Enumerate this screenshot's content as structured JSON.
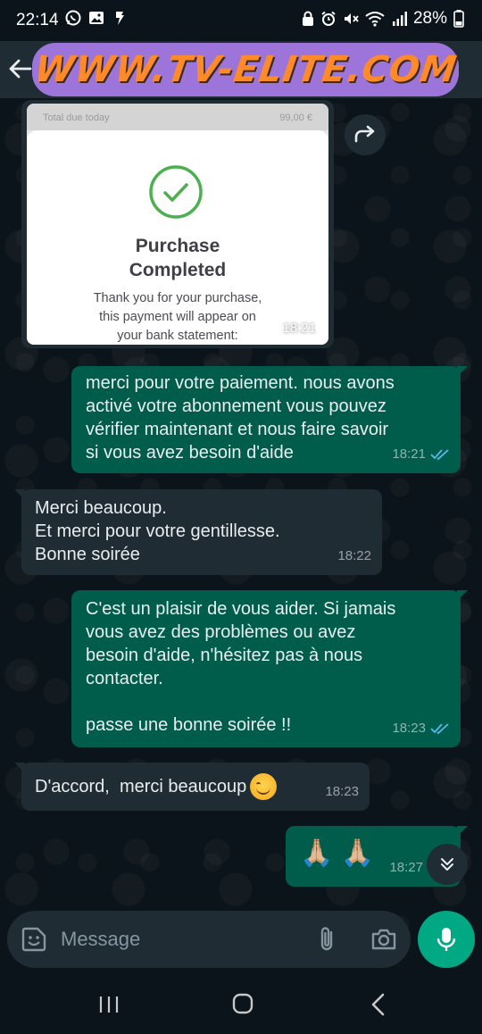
{
  "status_bar": {
    "time": "22:14",
    "battery": "28%",
    "left_icons": [
      "whatsapp-icon",
      "image-icon",
      "notification-icon"
    ],
    "right_icons": [
      "lock-icon",
      "alarm-icon",
      "mute-icon",
      "wifi-icon",
      "signal-icon",
      "battery-icon"
    ]
  },
  "header": {
    "banner_text": "WWW.TV-ELITE.COM",
    "banner_color": "#9d74d9",
    "banner_text_color": "#ff8a2a"
  },
  "image_message": {
    "receipt_row_left": "Total due today",
    "receipt_row_right": "99,00 €",
    "title_line1": "Purchase",
    "title_line2": "Completed",
    "desc_line1": "Thank you for your purchase,",
    "desc_line2": "this payment will appear on",
    "desc_line3": "your bank statement:",
    "time": "18:21"
  },
  "messages": [
    {
      "direction": "out",
      "text": "merci pour votre paiement. nous avons\nactivé votre abonnement vous pouvez\nvérifier maintenant et nous faire savoir\nsi vous avez besoin d'aide",
      "time": "18:21",
      "read": true
    },
    {
      "direction": "in",
      "text": "Merci beaucoup.\nEt merci pour votre gentillesse.\nBonne soirée",
      "time": "18:22"
    },
    {
      "direction": "out",
      "text": "C'est un plaisir de vous aider. Si jamais\nvous avez des problèmes ou avez\nbesoin d'aide, n'hésitez pas à nous\ncontacter.\n\npasse une bonne soirée  !!",
      "time": "18:23",
      "read": true
    },
    {
      "direction": "in",
      "text": "D'accord,  merci beaucoup",
      "emoji": "smiling-face",
      "time": "18:23"
    },
    {
      "direction": "out",
      "text": "🙏🏼 🙏🏼",
      "time": "18:27"
    }
  ],
  "composer": {
    "placeholder": "Message"
  },
  "colors": {
    "outgoing_bubble": "#005c4b",
    "incoming_bubble": "#1f2c34",
    "accent": "#00a884",
    "background": "#0b141a"
  }
}
